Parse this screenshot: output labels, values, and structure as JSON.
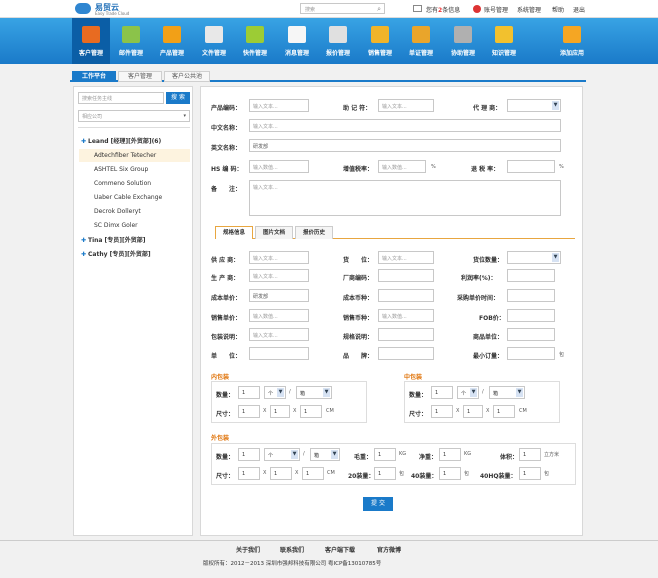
{
  "header": {
    "logo_cn": "易贸云",
    "logo_en": "Easy Trade Cloud",
    "search_placeholder": "搜索",
    "msg_prefix": "您有",
    "msg_count": "2",
    "msg_suffix": "条信息",
    "account": "账号管理",
    "system": "系统管理",
    "help": "帮助",
    "logout": "退出"
  },
  "nav": [
    {
      "label": "客户管理",
      "color": "#e86b21"
    },
    {
      "label": "邮件管理",
      "color": "#8bc34a"
    },
    {
      "label": "产品管理",
      "color": "#f2a017"
    },
    {
      "label": "文件管理",
      "color": "#e8e8e8"
    },
    {
      "label": "快件管理",
      "color": "#9ccc35"
    },
    {
      "label": "消息管理",
      "color": "#f6f6f6"
    },
    {
      "label": "报价管理",
      "color": "#e0e0e0"
    },
    {
      "label": "销售管理",
      "color": "#f0b429"
    },
    {
      "label": "单证管理",
      "color": "#e9a52b"
    },
    {
      "label": "协助管理",
      "color": "#b0b0b0"
    },
    {
      "label": "知识管理",
      "color": "#f2c12e"
    },
    {
      "label": "添加应用",
      "color": "#f5a623"
    }
  ],
  "tabs": [
    "工作平台",
    "客户管理",
    "客户公共池"
  ],
  "sidebar": {
    "search_placeholder": "搜索任务主线",
    "search_button": "搜 索",
    "company": "相应公司",
    "groups": [
      {
        "label": "Leand [经理][外贸部](6)",
        "children": [
          "Adtechfiber Tetecher",
          "ASHTEL Six Group",
          "Commeno Solution",
          "Uaber Cable Exchange",
          "Decrok Dolleryt",
          "SC Dimx Goler"
        ]
      },
      {
        "label": "Tina [专员][外贸部]"
      },
      {
        "label": "Cathy [专员][外贸部]"
      }
    ]
  },
  "form": {
    "product_code": "产品编码：",
    "memo": "助 记 符：",
    "agent": "代 理 商：",
    "cn_name": "中文名称：",
    "en_name": "英文名称：",
    "hs_code": "HS 编 码：",
    "vat_rate": "增值税率：",
    "tax_refund": "退 税 率：",
    "remark": "备　　注：",
    "ph_text": "输入文本...",
    "ph_num": "输入数值...",
    "en_value": "研发部",
    "percent": "%"
  },
  "subtabs": [
    "规格信息",
    "图片文档",
    "报价历史"
  ],
  "spec": {
    "supplier": "供 应 商：",
    "goods_no": "货　　位：",
    "goods_type": "货位数量：",
    "manufacturer": "生 产 商：",
    "factory_code": "厂商编码：",
    "profit_rate": "利润率(%)：",
    "cost_price": "成本单价：",
    "cost_currency": "成本币种：",
    "purchase_time": "采购单价时间：",
    "sale_price": "销售单价：",
    "sale_currency": "销售币种：",
    "fob": "FOB价：",
    "pack_desc": "包装说明：",
    "spec_desc": "规格说明：",
    "goods_unit": "商品单位：",
    "unit": "单　　位：",
    "brand": "品　　牌：",
    "min_order": "最小订量：",
    "unit_suffix": "包",
    "rd_value": "研发部"
  },
  "packing": {
    "inner_title": "内包装",
    "middle_title": "中包装",
    "outer_title": "外包装",
    "qty": "数量：",
    "size": "尺寸：",
    "one": "1",
    "piece": "个",
    "box": "箱",
    "slash": "/",
    "x": "X",
    "cm": "CM",
    "gross": "毛重：",
    "net": "净重：",
    "kg": "KG",
    "volume": "体积：",
    "cbm": "立方米",
    "c20": "20装量：",
    "c40": "40装量：",
    "c40hq": "40HQ装量：",
    "bag": "包"
  },
  "submit": "提 交",
  "footer": {
    "links": [
      "关于我们",
      "联系我们",
      "客户端下载",
      "官方微博"
    ],
    "copyright": "版权所有：2012－2013  深圳市强邦科技有限公司        粤ICP备13010785号"
  }
}
